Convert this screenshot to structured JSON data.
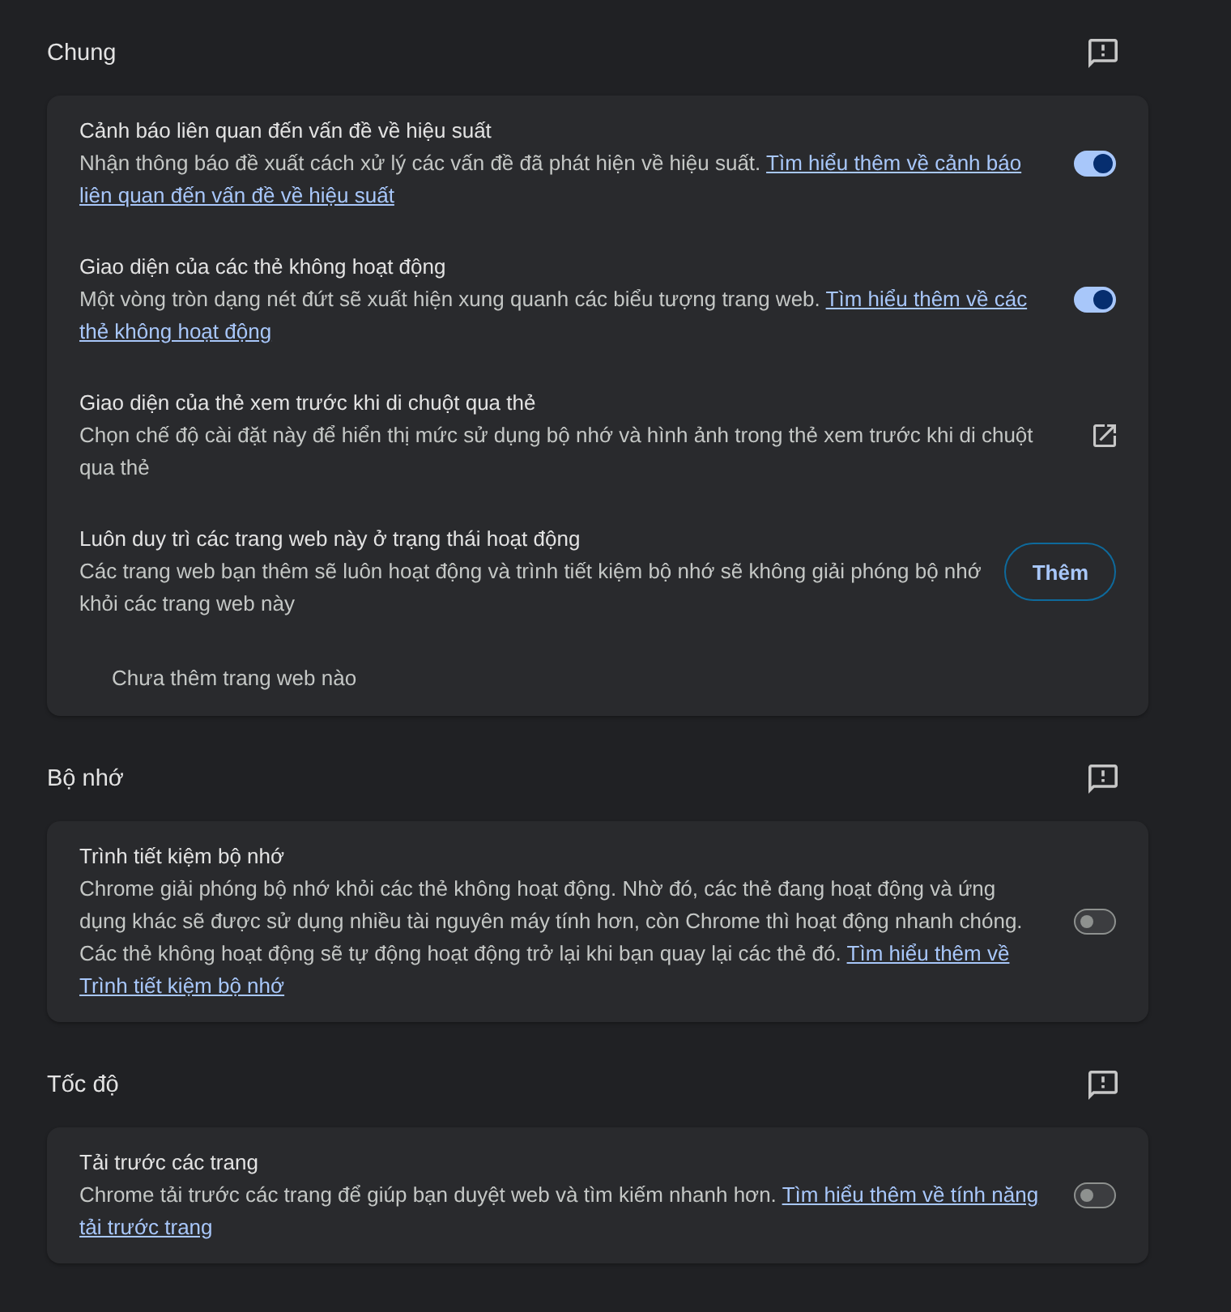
{
  "sections": [
    {
      "title": "Chung",
      "rows": [
        {
          "kind": "toggle",
          "title": "Cảnh báo liên quan đến vấn đề về hiệu suất",
          "description": "Nhận thông báo đề xuất cách xử lý các vấn đề đã phát hiện về hiệu suất.",
          "link": [
            "Tìm hiểu thêm về cảnh báo",
            "liên quan đến vấn đề về hiệu suất"
          ],
          "on": true
        },
        {
          "kind": "toggle",
          "title": "Giao diện của các thẻ không hoạt động",
          "description": "Một vòng tròn dạng nét đứt sẽ xuất hiện xung quanh các biểu tượng trang web.",
          "link": [
            "Tìm hiểu thêm về các",
            "thẻ không hoạt động"
          ],
          "on": true
        },
        {
          "kind": "external",
          "title": "Giao diện của thẻ xem trước khi di chuột qua thẻ",
          "description": "Chọn chế độ cài đặt này để hiển thị mức sử dụng bộ nhớ và hình ảnh trong thẻ xem trước khi di chuột qua thẻ"
        },
        {
          "kind": "button",
          "title": "Luôn duy trì các trang web này ở trạng thái hoạt động",
          "description": "Các trang web bạn thêm sẽ luôn hoạt động và trình tiết kiệm bộ nhớ sẽ không giải phóng bộ nhớ khỏi các trang web này",
          "button": "Thêm"
        }
      ],
      "empty_note": "Chưa thêm trang web nào"
    },
    {
      "title": "Bộ nhớ",
      "rows": [
        {
          "kind": "toggle",
          "title": "Trình tiết kiệm bộ nhớ",
          "description": "Chrome giải phóng bộ nhớ khỏi các thẻ không hoạt động. Nhờ đó, các thẻ đang hoạt động và ứng dụng khác sẽ được sử dụng nhiều tài nguyên máy tính hơn, còn Chrome thì hoạt động nhanh chóng. Các thẻ không hoạt động sẽ tự động hoạt động trở lại khi bạn quay lại các thẻ đó.",
          "link": [
            "Tìm hiểu thêm về",
            "Trình tiết kiệm bộ nhớ"
          ],
          "on": false
        }
      ]
    },
    {
      "title": "Tốc độ",
      "rows": [
        {
          "kind": "toggle",
          "title": "Tải trước các trang",
          "description": "Chrome tải trước các trang để giúp bạn duyệt web và tìm kiếm nhanh hơn.",
          "link": [
            "Tìm hiểu thêm về tính năng",
            "tải trước trang"
          ],
          "on": false
        }
      ]
    }
  ]
}
